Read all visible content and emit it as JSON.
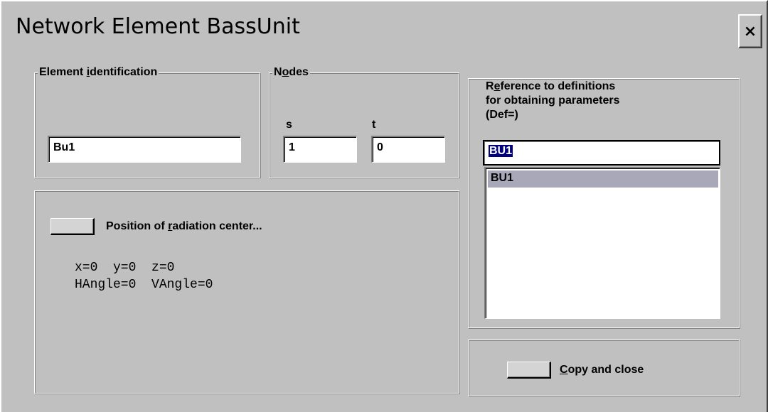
{
  "window": {
    "title": "Network Element BassUnit",
    "close_label": "×"
  },
  "element_identification": {
    "label_pre": "Element ",
    "label_accel": "i",
    "label_post": "dentification",
    "value": "Bu1"
  },
  "nodes": {
    "label_pre": "N",
    "label_accel": "o",
    "label_post": "des",
    "s_label": "s",
    "s_value": "1",
    "t_label": "t",
    "t_value": "0"
  },
  "radiation": {
    "button_label_pre": "Position of ",
    "button_label_accel": "r",
    "button_label_post": "adiation center...",
    "line1": "x=0  y=0  z=0",
    "line2": "HAngle=0  VAngle=0"
  },
  "reference": {
    "label_line1_pre": "R",
    "label_line1_accel": "e",
    "label_line1_post": "ference to definitions",
    "label_line2": "for obtaining parameters",
    "label_line3": "(Def=)",
    "input_value": "BU1",
    "list_items": [
      "BU1"
    ]
  },
  "copy_close": {
    "label_accel": "C",
    "label_post": "opy and close"
  }
}
